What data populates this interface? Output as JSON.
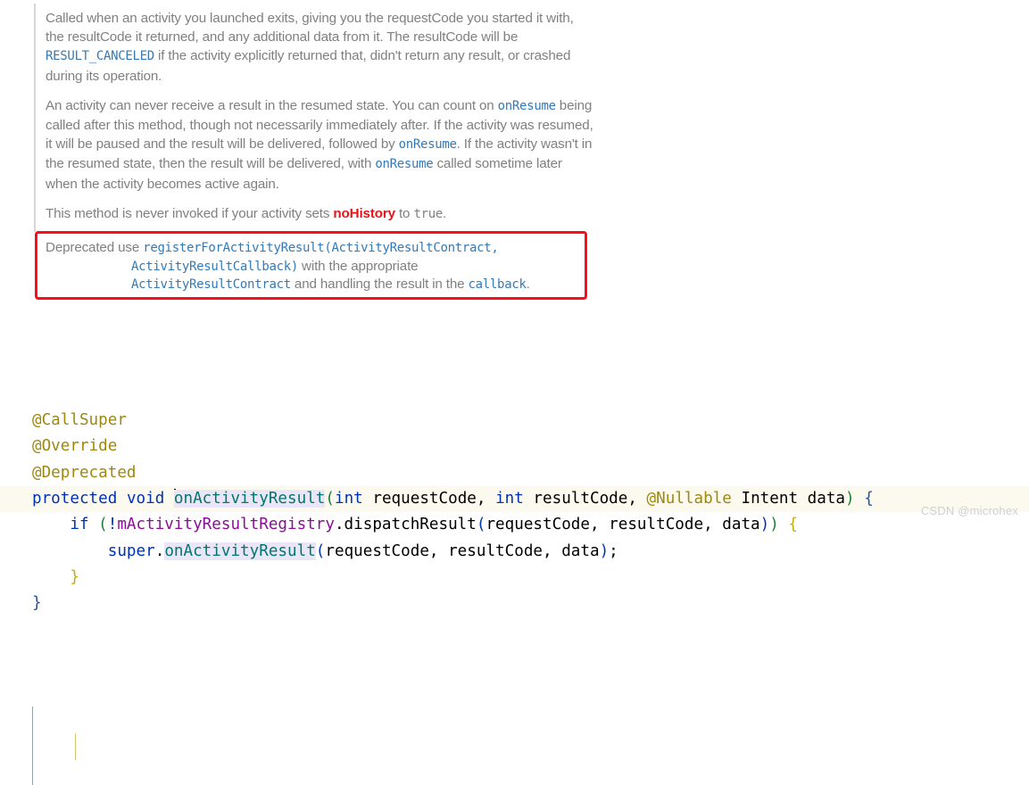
{
  "doc": {
    "paragraphs": [
      {
        "id": "p1",
        "segments": [
          {
            "text": "Called when an activity you launched exits, giving you the requestCode you started it with, the resultCode it returned, and any additional data from it. The resultCode will be ",
            "style": "plain"
          },
          {
            "text": "RESULT_CANCELED",
            "style": "code-link"
          },
          {
            "text": " if the activity explicitly returned that, didn't return any result, or crashed during its operation.",
            "style": "plain"
          }
        ]
      },
      {
        "id": "p2",
        "segments": [
          {
            "text": "An activity can never receive a result in the resumed state. You can count on ",
            "style": "plain"
          },
          {
            "text": "onResume",
            "style": "code-link"
          },
          {
            "text": " being called after this method, though not necessarily immediately after. If the activity was resumed, it will be paused and the result will be delivered, followed by ",
            "style": "plain"
          },
          {
            "text": "onResume",
            "style": "code-link"
          },
          {
            "text": ". If the activity wasn't in the resumed state, then the result will be delivered, with ",
            "style": "plain"
          },
          {
            "text": "onResume",
            "style": "code-link"
          },
          {
            "text": " called sometime later when the activity becomes active again.",
            "style": "plain"
          }
        ]
      },
      {
        "id": "p3",
        "segments": [
          {
            "text": "This method is never invoked if your activity sets ",
            "style": "plain"
          },
          {
            "text": "noHistory",
            "style": "keyword-red"
          },
          {
            "text": " to ",
            "style": "plain"
          },
          {
            "text": "true",
            "style": "code-plain"
          },
          {
            "text": ".",
            "style": "plain"
          }
        ]
      }
    ]
  },
  "deprecated_box": {
    "label": "Deprecated use",
    "line1_code": "registerForActivityResult(ActivityResultContract,",
    "line2_code": "ActivityResultCallback)",
    "line2_text": " with the appropriate",
    "line3_code": "ActivityResultContract",
    "line3_text": " and handling the result in the ",
    "line3_code2": "callback",
    "line3_end": ".",
    "border_color": "#fb0d1b"
  },
  "code": {
    "lines": [
      {
        "id": "line-callsuper",
        "current": false,
        "tokens": [
          {
            "t": "@CallSuper",
            "c": "anno"
          }
        ]
      },
      {
        "id": "line-override",
        "current": false,
        "tokens": [
          {
            "t": "@Override",
            "c": "anno"
          }
        ]
      },
      {
        "id": "line-deprecated",
        "current": false,
        "tokens": [
          {
            "t": "@Deprecated",
            "c": "anno"
          }
        ]
      },
      {
        "id": "line-signature",
        "current": true,
        "tokens": [
          {
            "t": "protected",
            "c": "kw"
          },
          {
            "t": " ",
            "c": "plain"
          },
          {
            "t": "void",
            "c": "kw"
          },
          {
            "t": " ",
            "c": "plain"
          },
          {
            "t": "",
            "c": "caret"
          },
          {
            "t": "onActivityResult",
            "c": "method-hl"
          },
          {
            "t": "(",
            "c": "punct-green"
          },
          {
            "t": "int",
            "c": "kw"
          },
          {
            "t": " requestCode, ",
            "c": "plain"
          },
          {
            "t": "int",
            "c": "kw"
          },
          {
            "t": " resultCode, ",
            "c": "plain"
          },
          {
            "t": "@Nullable",
            "c": "anno"
          },
          {
            "t": " Intent data",
            "c": "plain"
          },
          {
            "t": ")",
            "c": "punct-green"
          },
          {
            "t": " ",
            "c": "plain"
          },
          {
            "t": "{",
            "c": "brace-b"
          }
        ]
      },
      {
        "id": "line-if",
        "current": false,
        "tokens": [
          {
            "t": "    ",
            "c": "plain"
          },
          {
            "t": "if",
            "c": "kw"
          },
          {
            "t": " ",
            "c": "plain"
          },
          {
            "t": "(",
            "c": "punct-green"
          },
          {
            "t": "!",
            "c": "punct-blue"
          },
          {
            "t": "mActivityResultRegistry",
            "c": "field"
          },
          {
            "t": ".dispatchResult",
            "c": "plain"
          },
          {
            "t": "(",
            "c": "punct-blue"
          },
          {
            "t": "requestCode, resultCode, data",
            "c": "plain"
          },
          {
            "t": ")",
            "c": "punct-blue"
          },
          {
            "t": ")",
            "c": "punct-green"
          },
          {
            "t": " ",
            "c": "plain"
          },
          {
            "t": "{",
            "c": "brace-y"
          }
        ]
      },
      {
        "id": "line-super",
        "current": false,
        "tokens": [
          {
            "t": "        ",
            "c": "plain"
          },
          {
            "t": "super",
            "c": "kw"
          },
          {
            "t": ".",
            "c": "plain"
          },
          {
            "t": "onActivityResult",
            "c": "method-hl"
          },
          {
            "t": "(",
            "c": "punct-blue"
          },
          {
            "t": "requestCode, resultCode, data",
            "c": "plain"
          },
          {
            "t": ")",
            "c": "punct-blue"
          },
          {
            "t": ";",
            "c": "plain"
          }
        ]
      },
      {
        "id": "line-close-inner",
        "current": false,
        "tokens": [
          {
            "t": "    ",
            "c": "plain"
          },
          {
            "t": "}",
            "c": "brace-y"
          }
        ]
      },
      {
        "id": "line-close-outer",
        "current": false,
        "tokens": [
          {
            "t": "}",
            "c": "brace-b"
          }
        ]
      }
    ]
  },
  "watermark": {
    "text": "CSDN @microhex"
  }
}
